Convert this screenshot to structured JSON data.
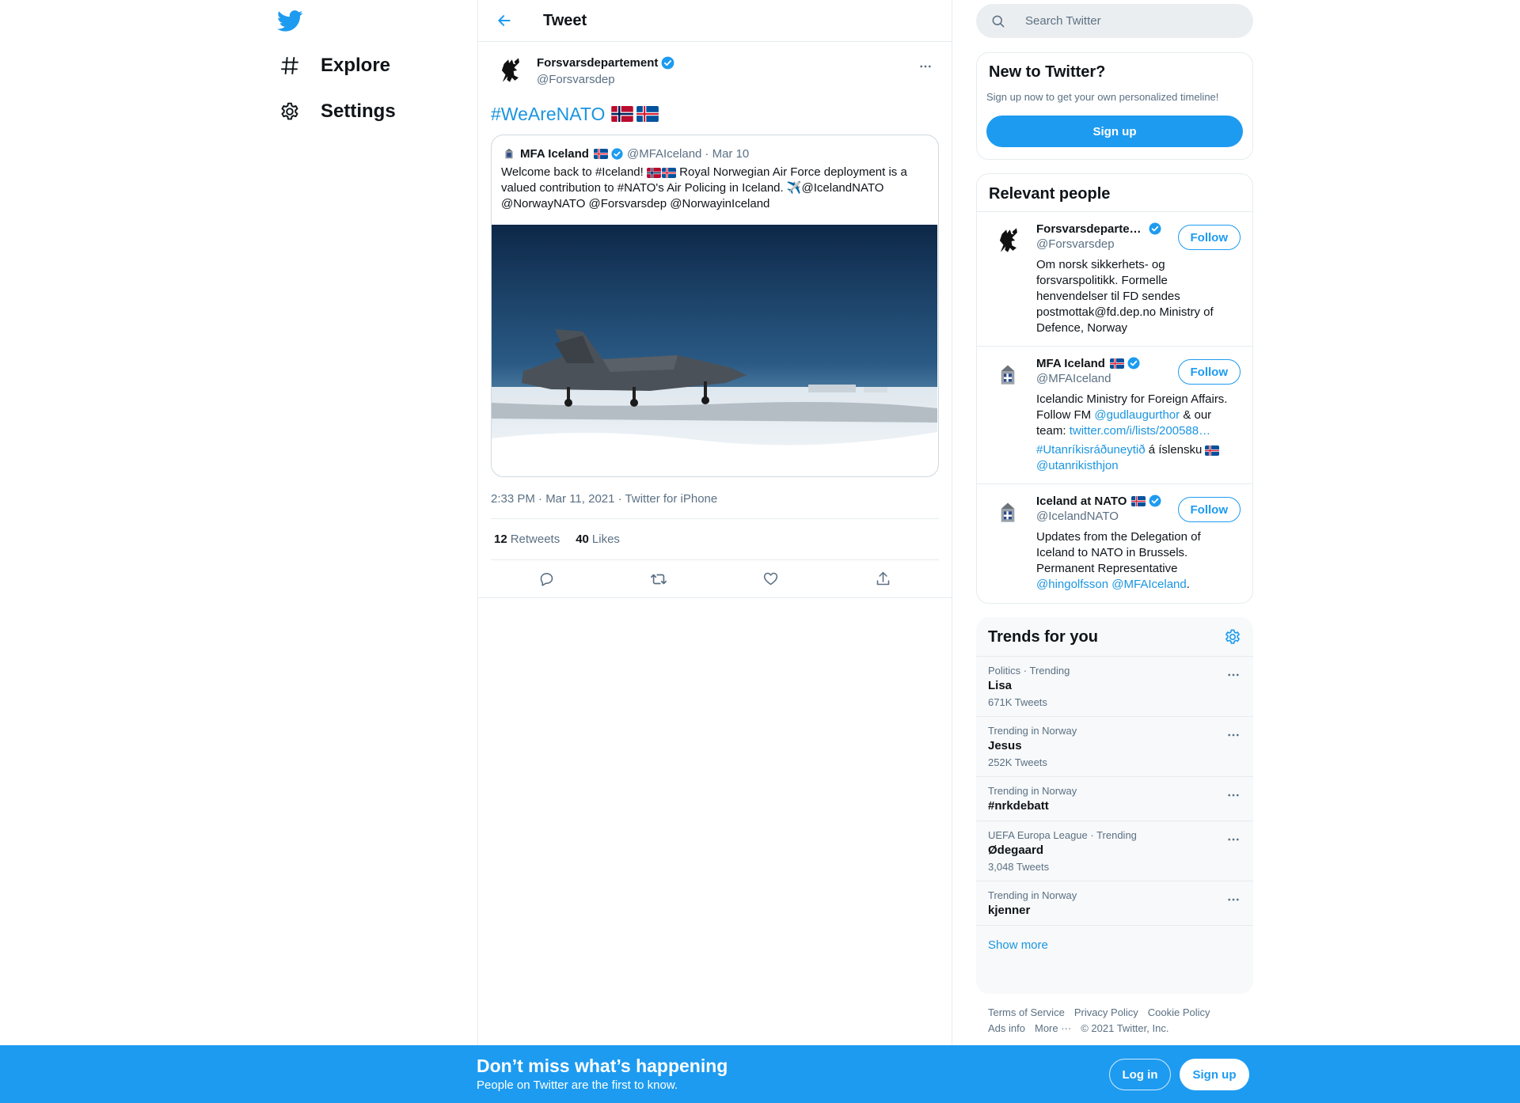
{
  "nav": {
    "logo_icon": "twitter-bird-icon",
    "items": [
      {
        "label": "Explore",
        "icon": "hashtag-icon"
      },
      {
        "label": "Settings",
        "icon": "gear-icon"
      }
    ]
  },
  "header": {
    "title": "Tweet"
  },
  "tweet": {
    "author_name": "Forsvarsdepartement",
    "author_handle": "@Forsvarsdep",
    "hashtag": "#WeAreNATO",
    "flags": [
      "norway-flag",
      "iceland-flag"
    ],
    "quote": {
      "name": "MFA Iceland",
      "handle": "@MFAIceland",
      "date": "· Mar 10",
      "text_part1": "Welcome back to #Iceland!",
      "text_part2": "Royal Norwegian Air Force deployment is a valued contribution to #NATO's Air Policing in Iceland. ✈️@IcelandNATO @NorwayNATO @Forsvarsdep @NorwayinIceland",
      "image": "f35-jet-on-snowy-airfield"
    },
    "meta": "2:33 PM · Mar 11, 2021 · Twitter for iPhone",
    "retweets_count": "12",
    "retweets_label": "Retweets",
    "likes_count": "40",
    "likes_label": "Likes"
  },
  "search": {
    "placeholder": "Search Twitter"
  },
  "new_to_twitter": {
    "title": "New to Twitter?",
    "subtitle": "Sign up now to get your own personalized timeline!",
    "button": "Sign up"
  },
  "relevant_people": {
    "title": "Relevant people",
    "follow_label": "Follow",
    "people": [
      {
        "name": "Forsvarsdeparte…",
        "handle": "@Forsvarsdep",
        "bio": "Om norsk sikkerhets- og forsvarspolitikk. Formelle henvendelser til FD sendes postmottak@fd.dep.no Ministry of Defence, Norway"
      },
      {
        "name": "MFA Iceland",
        "handle": "@MFAIceland",
        "bio_a": "Icelandic Ministry for Foreign Affairs. Follow FM ",
        "bio_link1": "@gudlaugurthor",
        "bio_b": " & our team: ",
        "bio_link2": "twitter.com/i/lists/200588…",
        "bio_link3": "#Utanríkisráðuneytið",
        "bio_c": " á íslensku ",
        "bio_link4": "@utanrikisthjon"
      },
      {
        "name": "Iceland at NATO",
        "handle": "@IcelandNATO",
        "bio_a": "Updates from the Delegation of Iceland to NATO in Brussels. Permanent Representative ",
        "bio_link1": "@hingolfsson",
        "bio_link2": "@MFAIceland",
        "bio_end": "."
      }
    ]
  },
  "trends": {
    "title": "Trends for you",
    "items": [
      {
        "context": "Politics · Trending",
        "name": "Lisa",
        "count": "671K Tweets"
      },
      {
        "context": "Trending in Norway",
        "name": "Jesus",
        "count": "252K Tweets"
      },
      {
        "context": "Trending in Norway",
        "name": "#nrkdebatt",
        "count": ""
      },
      {
        "context": "UEFA Europa League · Trending",
        "name": "Ødegaard",
        "count": "3,048 Tweets"
      },
      {
        "context": "Trending in Norway",
        "name": "kjenner",
        "count": ""
      }
    ],
    "show_more": "Show more"
  },
  "footer": {
    "links": [
      "Terms of Service",
      "Privacy Policy",
      "Cookie Policy",
      "Ads info",
      "More ···"
    ],
    "copyright": "© 2021 Twitter, Inc."
  },
  "bottom_bar": {
    "title": "Don’t miss what’s happening",
    "subtitle": "People on Twitter are the first to know.",
    "login": "Log in",
    "signup": "Sign up"
  },
  "colors": {
    "accent": "#1d9bf0",
    "link": "#1b95e0",
    "text_secondary": "#5b7083",
    "border": "#e6ecf0"
  }
}
